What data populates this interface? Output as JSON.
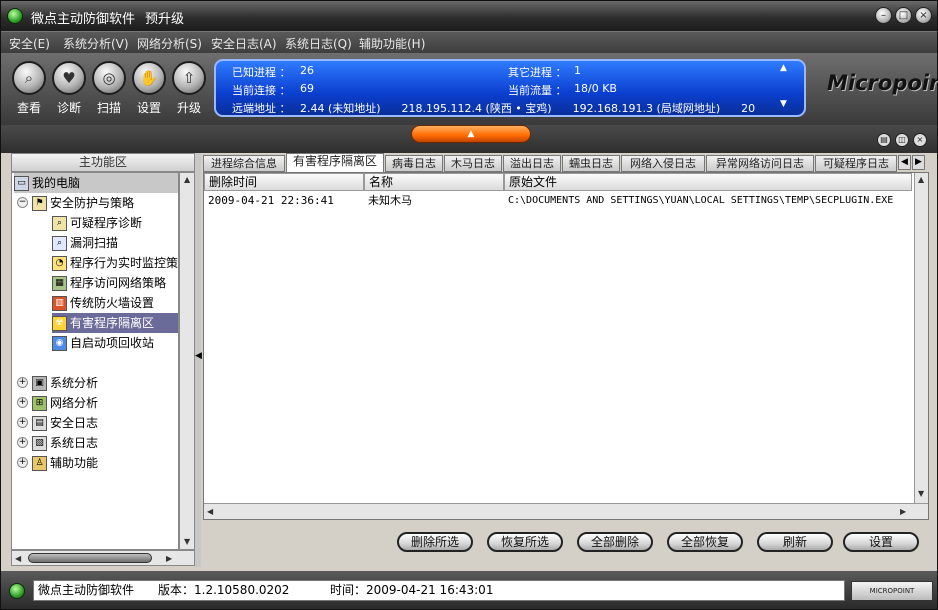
{
  "window": {
    "title": "微点主动防御软件",
    "subtitle": "预升级"
  },
  "menu": [
    {
      "label": "安全(E)"
    },
    {
      "label": "系统分析(V)"
    },
    {
      "label": "网络分析(S)"
    },
    {
      "label": "安全日志(A)"
    },
    {
      "label": "系统日志(Q)"
    },
    {
      "label": "辅助功能(H)"
    }
  ],
  "toolbar": [
    {
      "label": "查看",
      "icon": "magnifier-icon"
    },
    {
      "label": "诊断",
      "icon": "heartbeat-icon"
    },
    {
      "label": "扫描",
      "icon": "scan-icon"
    },
    {
      "label": "设置",
      "icon": "hand-settings-icon"
    },
    {
      "label": "升级",
      "icon": "upgrade-arrow-icon"
    }
  ],
  "info": {
    "known_processes_label": "已知进程 ：",
    "known_processes_value": "26",
    "other_processes_label": "其它进程 ：",
    "other_processes_value": "1",
    "connections_label": "当前连接 ：",
    "connections_value": "69",
    "traffic_label": "当前流量 ：",
    "traffic_value": "18/0 KB",
    "remote_label": "远端地址 ：",
    "remote_value": "2.44 (未知地址)      218.195.112.4 (陕西 • 宝鸡)      192.168.191.3 (局域网地址)      20"
  },
  "logo": "Micropoint",
  "left_panel": {
    "header": "主功能区",
    "tree": [
      {
        "label": "我的电脑",
        "level": 0,
        "icon": "computer-icon"
      },
      {
        "label": "安全防护与策略",
        "level": 1,
        "icon": "flag-icon",
        "expander": "-"
      },
      {
        "label": "可疑程序诊断",
        "level": 2,
        "icon": "diagnose-icon"
      },
      {
        "label": "漏洞扫描",
        "level": 2,
        "icon": "search-icon"
      },
      {
        "label": "程序行为实时监控策",
        "level": 2,
        "icon": "monitor-icon"
      },
      {
        "label": "程序访问网络策略",
        "level": 2,
        "icon": "network-policy-icon"
      },
      {
        "label": "传统防火墙设置",
        "level": 2,
        "icon": "firewall-icon"
      },
      {
        "label": "有害程序隔离区",
        "level": 2,
        "icon": "quarantine-icon",
        "selected": true
      },
      {
        "label": "自启动项回收站",
        "level": 2,
        "icon": "recycle-icon"
      },
      {
        "label": "系统分析",
        "level": 1,
        "icon": "system-icon",
        "expander": "+"
      },
      {
        "label": "网络分析",
        "level": 1,
        "icon": "network-icon",
        "expander": "+"
      },
      {
        "label": "安全日志",
        "level": 1,
        "icon": "security-log-icon",
        "expander": "+"
      },
      {
        "label": "系统日志",
        "level": 1,
        "icon": "system-log-icon",
        "expander": "+"
      },
      {
        "label": "辅助功能",
        "level": 1,
        "icon": "tools-icon",
        "expander": "+"
      }
    ]
  },
  "tabs": [
    {
      "label": "进程综合信息"
    },
    {
      "label": "有害程序隔离区",
      "active": true
    },
    {
      "label": "病毒日志"
    },
    {
      "label": "木马日志"
    },
    {
      "label": "溢出日志"
    },
    {
      "label": "蠕虫日志"
    },
    {
      "label": "网络入侵日志"
    },
    {
      "label": "异常网络访问日志"
    },
    {
      "label": "可疑程序日志"
    }
  ],
  "table": {
    "columns": [
      "删除时间",
      "名称",
      "原始文件"
    ],
    "rows": [
      [
        "2009-04-21 22:36:41",
        "未知木马",
        "C:\\DOCUMENTS AND SETTINGS\\YUAN\\LOCAL SETTINGS\\TEMP\\SECPLUGIN.EXE"
      ]
    ]
  },
  "buttons": [
    {
      "label": "删除所选"
    },
    {
      "label": "恢复所选"
    },
    {
      "label": "全部删除"
    },
    {
      "label": "全部恢复"
    },
    {
      "label": "刷新"
    },
    {
      "label": "设置"
    }
  ],
  "status": {
    "app": "微点主动防御软件",
    "version": "版本：1.2.10580.0202",
    "time": "时间：2009-04-21 16:43:01",
    "badge": "MICROPOINT"
  }
}
